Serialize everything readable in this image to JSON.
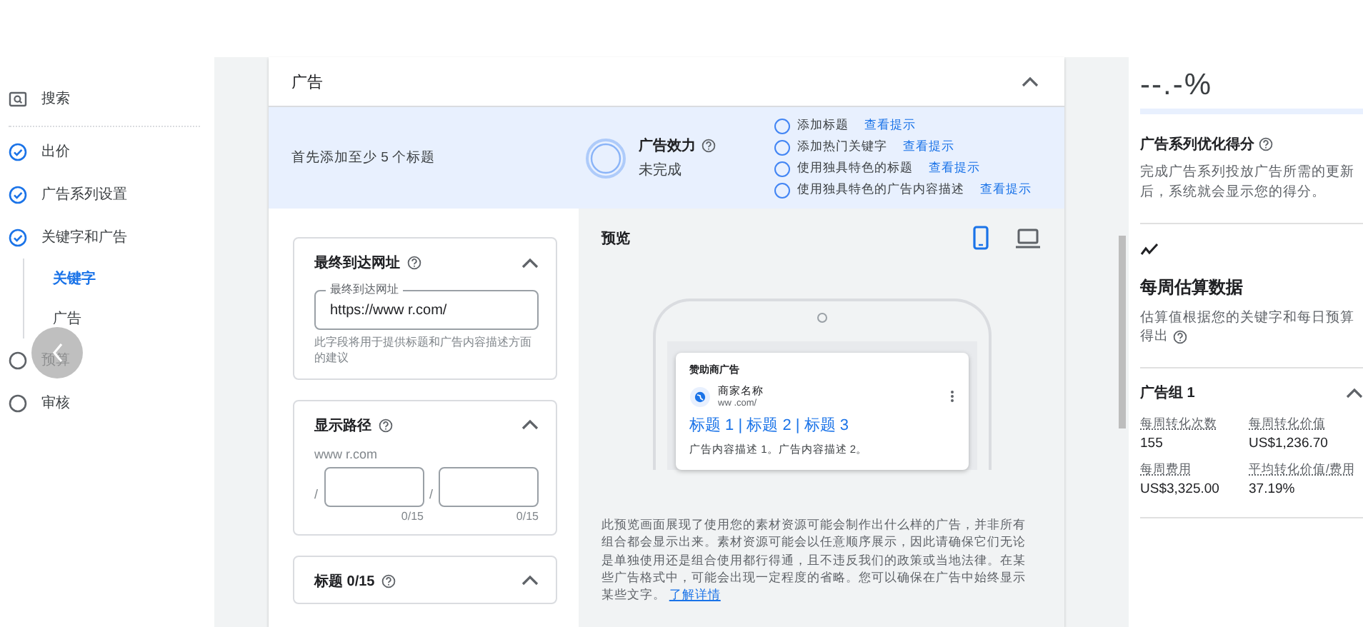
{
  "sidebar": {
    "search": "搜索",
    "steps": [
      {
        "label": "出价",
        "done": true
      },
      {
        "label": "广告系列设置",
        "done": true
      },
      {
        "label": "关键字和广告",
        "done": true,
        "children": [
          {
            "label": "关键字",
            "selected": true
          },
          {
            "label": "广告",
            "selected": false
          }
        ]
      },
      {
        "label": "预算",
        "done": false
      },
      {
        "label": "审核",
        "done": false
      }
    ]
  },
  "ad_card": {
    "title": "广告",
    "expanded": true,
    "strength": {
      "hint": "首先添加至少 5 个标题",
      "label": "广告效力",
      "status": "未完成",
      "tips": [
        {
          "text": "添加标题",
          "link": "查看提示",
          "checked": false
        },
        {
          "text": "添加热门关键字",
          "link": "查看提示",
          "checked": false
        },
        {
          "text": "使用独具特色的标题",
          "link": "查看提示",
          "checked": false
        },
        {
          "text": "使用独具特色的广告内容描述",
          "link": "查看提示",
          "checked": false
        }
      ]
    },
    "sections": [
      {
        "kind": "url",
        "title": "最终到达网址",
        "expanded": true,
        "field_label": "最终到达网址",
        "value": "https://www r.com/",
        "helper": "此字段将用于提供标题和广告内容描述方面的建议"
      },
      {
        "kind": "path",
        "title": "显示路径",
        "expanded": true,
        "domain": "www r.com",
        "separator": "/",
        "counters": [
          "0/15",
          "0/15"
        ]
      },
      {
        "kind": "headline",
        "title": "标题 0/15",
        "expanded": true
      }
    ],
    "preview": {
      "title": "预览",
      "devices": [
        {
          "kind": "mobile",
          "selected": true
        },
        {
          "kind": "desktop",
          "selected": false
        }
      ],
      "ad": {
        "sponsored": "赞助商广告",
        "business": "商家名称",
        "url": "ww .com/",
        "headline": "标题 1 | 标题 2 | 标题 3",
        "description": "广告内容描述 1。广告内容描述 2。"
      },
      "note": "此预览画面展现了使用您的素材资源可能会制作出什么样的广告，并非所有组合都会显示出来。素材资源可能会以任意顺序展示，因此请确保它们无论是单独使用还是组合使用都行得通，且不违反我们的政策或当地法律。在某些广告格式中，可能会出现一定程度的省略。您可以确保在广告中始终显示某些文字。",
      "note_link": "了解详情"
    }
  },
  "right_panel": {
    "score": "--.-%",
    "score_title": "广告系列优化得分",
    "score_text": "完成广告系列投放广告所需的更新后，系统就会显示您的得分。",
    "weekly_title": "每周估算数据",
    "weekly_text": "估算值根据您的关键字和每日预算得出",
    "ad_group": {
      "title": "广告组 1",
      "expanded": true,
      "stats": [
        {
          "label": "每周转化次数",
          "value": "155"
        },
        {
          "label": "每周转化价值",
          "value": "US$1,236.70"
        },
        {
          "label": "每周费用",
          "value": "US$3,325.00"
        },
        {
          "label": "平均转化价值/费用",
          "value": "37.19%"
        }
      ]
    }
  }
}
